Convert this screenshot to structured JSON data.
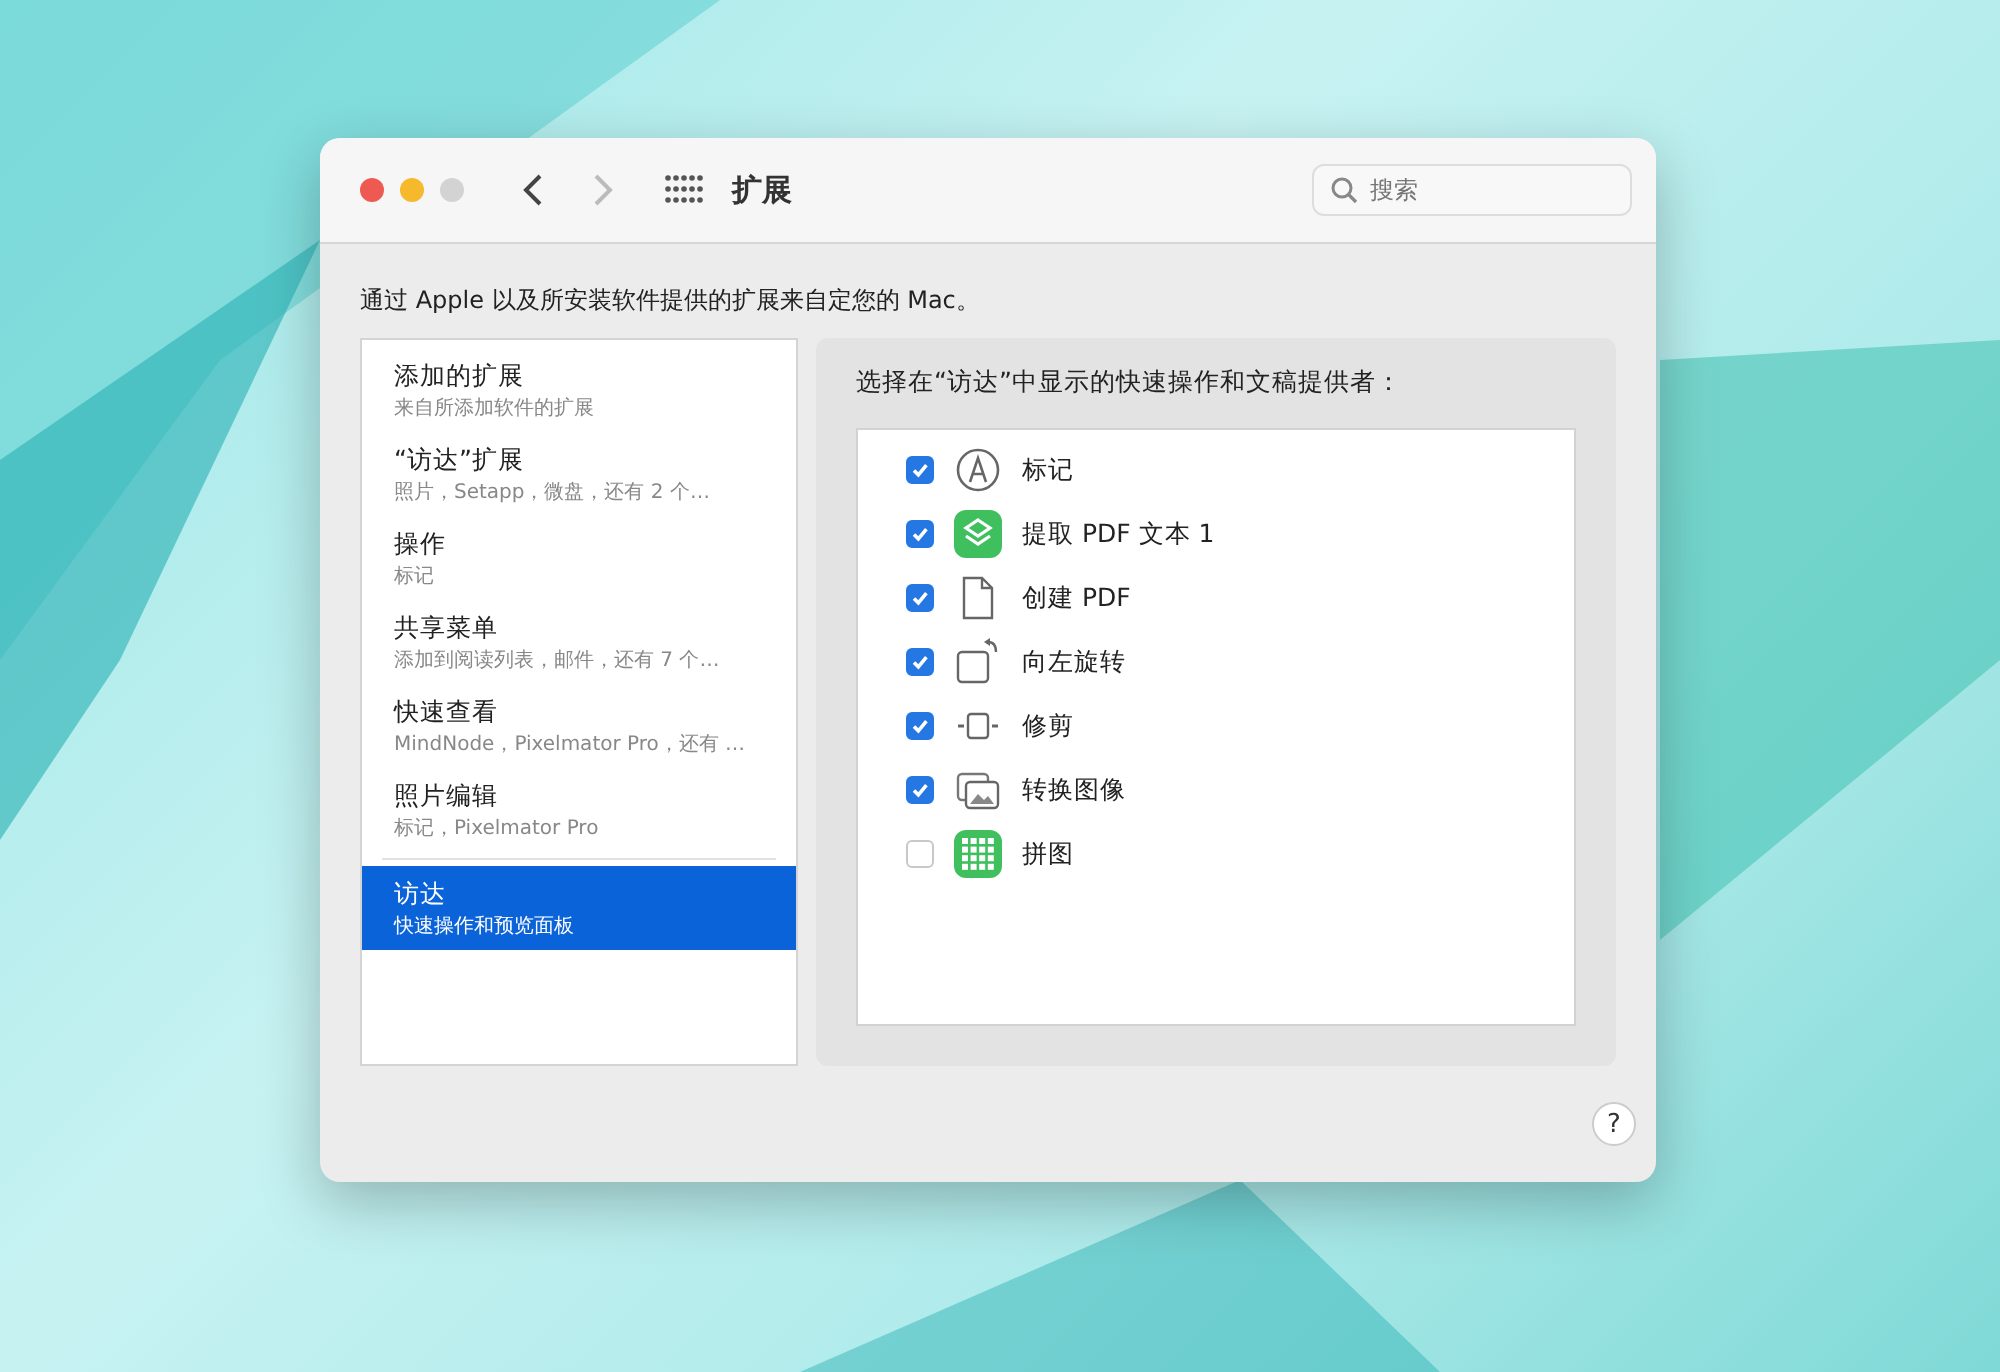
{
  "window": {
    "title": "扩展",
    "search": {
      "placeholder": "搜索"
    }
  },
  "description": "通过 Apple 以及所安装软件提供的扩展来自定您的 Mac。",
  "sidebar": {
    "items": [
      {
        "title": "添加的扩展",
        "subtitle": "来自所添加软件的扩展",
        "selected": false,
        "separator_before": false
      },
      {
        "title": "“访达”扩展",
        "subtitle": "照片，Setapp，微盘，还有 2 个…",
        "selected": false,
        "separator_before": false
      },
      {
        "title": "操作",
        "subtitle": "标记",
        "selected": false,
        "separator_before": false
      },
      {
        "title": "共享菜单",
        "subtitle": "添加到阅读列表，邮件，还有 7 个…",
        "selected": false,
        "separator_before": false
      },
      {
        "title": "快速查看",
        "subtitle": "MindNode，Pixelmator Pro，还有 …",
        "selected": false,
        "separator_before": false
      },
      {
        "title": "照片编辑",
        "subtitle": "标记，Pixelmator Pro",
        "selected": false,
        "separator_before": false
      },
      {
        "title": "访达",
        "subtitle": "快速操作和预览面板",
        "selected": true,
        "separator_before": true
      }
    ]
  },
  "panel": {
    "heading": "选择在“访达”中显示的快速操作和文稿提供者：",
    "items": [
      {
        "label": "标记",
        "checked": true,
        "kind": "markup"
      },
      {
        "label": "提取 PDF 文本 1",
        "checked": true,
        "kind": "shortcut"
      },
      {
        "label": "创建 PDF",
        "checked": true,
        "kind": "document"
      },
      {
        "label": "向左旋转",
        "checked": true,
        "kind": "rotate"
      },
      {
        "label": "修剪",
        "checked": true,
        "kind": "trim"
      },
      {
        "label": "转换图像",
        "checked": true,
        "kind": "image"
      },
      {
        "label": "拼图",
        "checked": false,
        "kind": "grid"
      }
    ]
  },
  "help": "?"
}
